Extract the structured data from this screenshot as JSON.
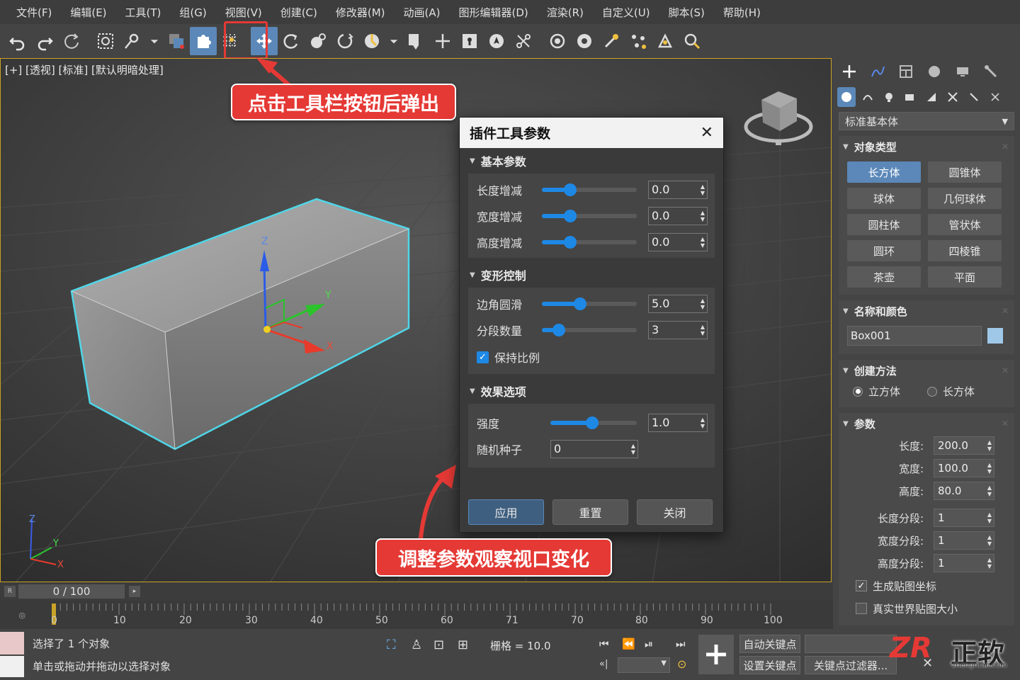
{
  "menu": [
    "文件(F)",
    "编辑(E)",
    "工具(T)",
    "组(G)",
    "视图(V)",
    "创建(C)",
    "修改器(M)",
    "动画(A)",
    "图形编辑器(D)",
    "渲染(R)",
    "自定义(U)",
    "脚本(S)",
    "帮助(H)"
  ],
  "viewport": {
    "label": "[+] [透视] [标准] [默认明暗处理]",
    "axis_x": "X",
    "axis_y": "Y",
    "axis_z": "Z"
  },
  "callouts": {
    "top": "点击工具栏按钮后弹出",
    "bottom": "调整参数观察视口变化"
  },
  "dialog": {
    "title": "插件工具参数",
    "sections": {
      "basic": "基本参数",
      "deform": "变形控制",
      "effect": "效果选项"
    },
    "length_label": "长度增减",
    "length_value": "0.0",
    "length_pct": 0.3,
    "width_label": "宽度增减",
    "width_value": "0.0",
    "width_pct": 0.3,
    "height_label": "高度增减",
    "height_value": "0.0",
    "height_pct": 0.3,
    "corner_label": "边角圆滑",
    "corner_value": "5.0",
    "corner_pct": 0.4,
    "segments_label": "分段数量",
    "segments_value": "3",
    "segments_pct": 0.18,
    "keep_ratio_label": "保持比例",
    "strength_label": "强度",
    "strength_value": "1.0",
    "strength_pct": 0.48,
    "seed_label": "随机种子",
    "seed_value": "0",
    "apply": "应用",
    "reset": "重置",
    "close": "关闭"
  },
  "panel": {
    "category": "标准基本体",
    "object_type": "对象类型",
    "objects": [
      "长方体",
      "圆锥体",
      "球体",
      "几何球体",
      "圆柱体",
      "管状体",
      "圆环",
      "四棱锥",
      "茶壶",
      "平面"
    ],
    "name_color": "名称和颜色",
    "name": "Box001",
    "swatch_color": "#9fc8e8",
    "creation_method": "创建方法",
    "method_cube": "立方体",
    "method_box": "长方体",
    "parameters": "参数",
    "length_label": "长度:",
    "length": "200.0",
    "width_label": "宽度:",
    "width": "100.0",
    "height_label": "高度:",
    "height": "80.0",
    "lseg_label": "长度分段:",
    "lseg": "1",
    "wseg_label": "宽度分段:",
    "wseg": "1",
    "hseg_label": "高度分段:",
    "hseg": "1",
    "gen_map": "生成贴图坐标",
    "real_world": "真实世界贴图大小"
  },
  "time": {
    "frame": "0 / 100",
    "ticks": [
      "0",
      "10",
      "20",
      "30",
      "40",
      "50",
      "60",
      "71",
      "70",
      "80",
      "90",
      "100"
    ]
  },
  "status": {
    "selected": "选择了 1 个对象",
    "hint": "单击或拖动并拖动以选择对象",
    "grid": "栅格 = 10.0",
    "auto_key": "自动关键点",
    "set_key": "设置关键点",
    "key_filter": "关键点过滤器..."
  },
  "watermark": {
    "logo": "ZR",
    "cn": "正软",
    "url": "zhengruan.com"
  },
  "colors": {
    "accent": "#5b88b8",
    "highlight": "#e53935",
    "selection": "#4fd6e8",
    "viewport_border": "#c9a227"
  }
}
